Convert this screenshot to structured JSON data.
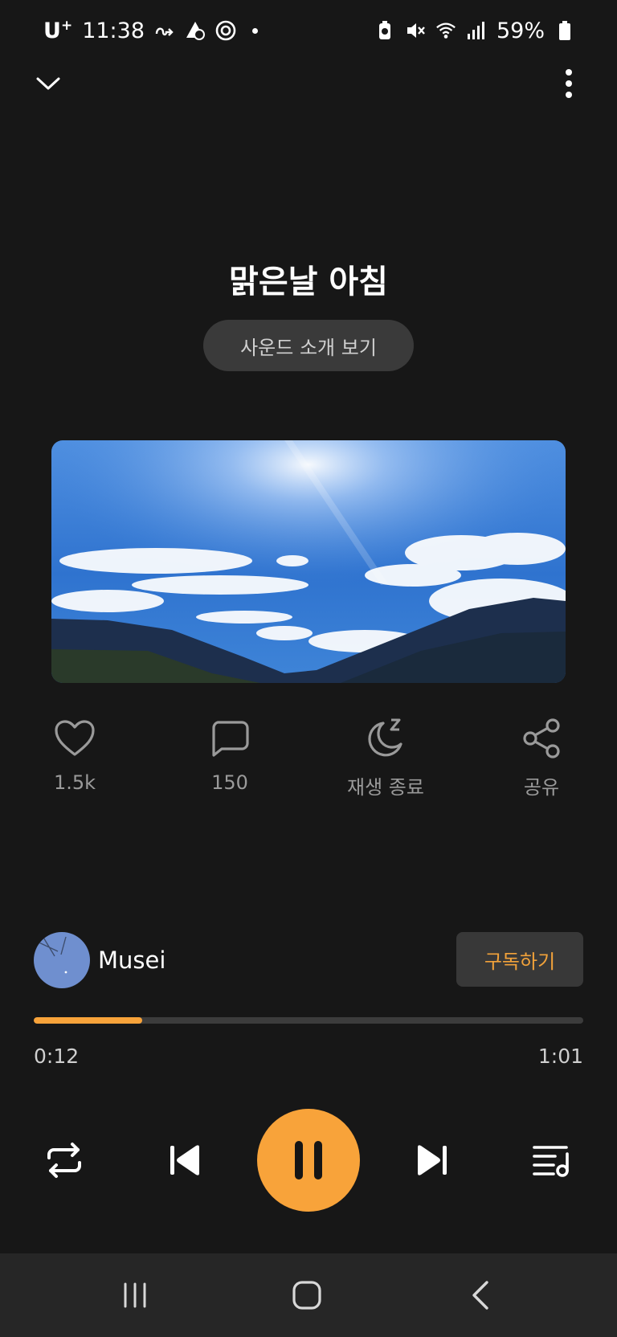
{
  "status_bar": {
    "carrier": "U",
    "carrier_sup": "+",
    "time": "11:38",
    "battery": "59%"
  },
  "header": {
    "collapse_icon": "chevron-down-icon",
    "more_icon": "more-vertical-icon"
  },
  "track": {
    "title": "맑은날 아침",
    "intro_button": "사운드 소개 보기"
  },
  "actions": [
    {
      "icon": "heart-icon",
      "label": "1.5k"
    },
    {
      "icon": "comment-icon",
      "label": "150"
    },
    {
      "icon": "sleep-timer-icon",
      "label": "재생 종료"
    },
    {
      "icon": "share-icon",
      "label": "공유"
    }
  ],
  "channel": {
    "name": "Musei",
    "subscribe_label": "구독하기"
  },
  "playback": {
    "elapsed": "0:12",
    "duration": "1:01",
    "progress_fraction": 0.197
  },
  "controls": {
    "repeat_icon": "repeat-icon",
    "prev_icon": "skip-previous-icon",
    "play_state_icon": "pause-icon",
    "next_icon": "skip-next-icon",
    "playlist_icon": "playlist-icon"
  },
  "colors": {
    "accent": "#f8a33a",
    "background": "#171717"
  }
}
